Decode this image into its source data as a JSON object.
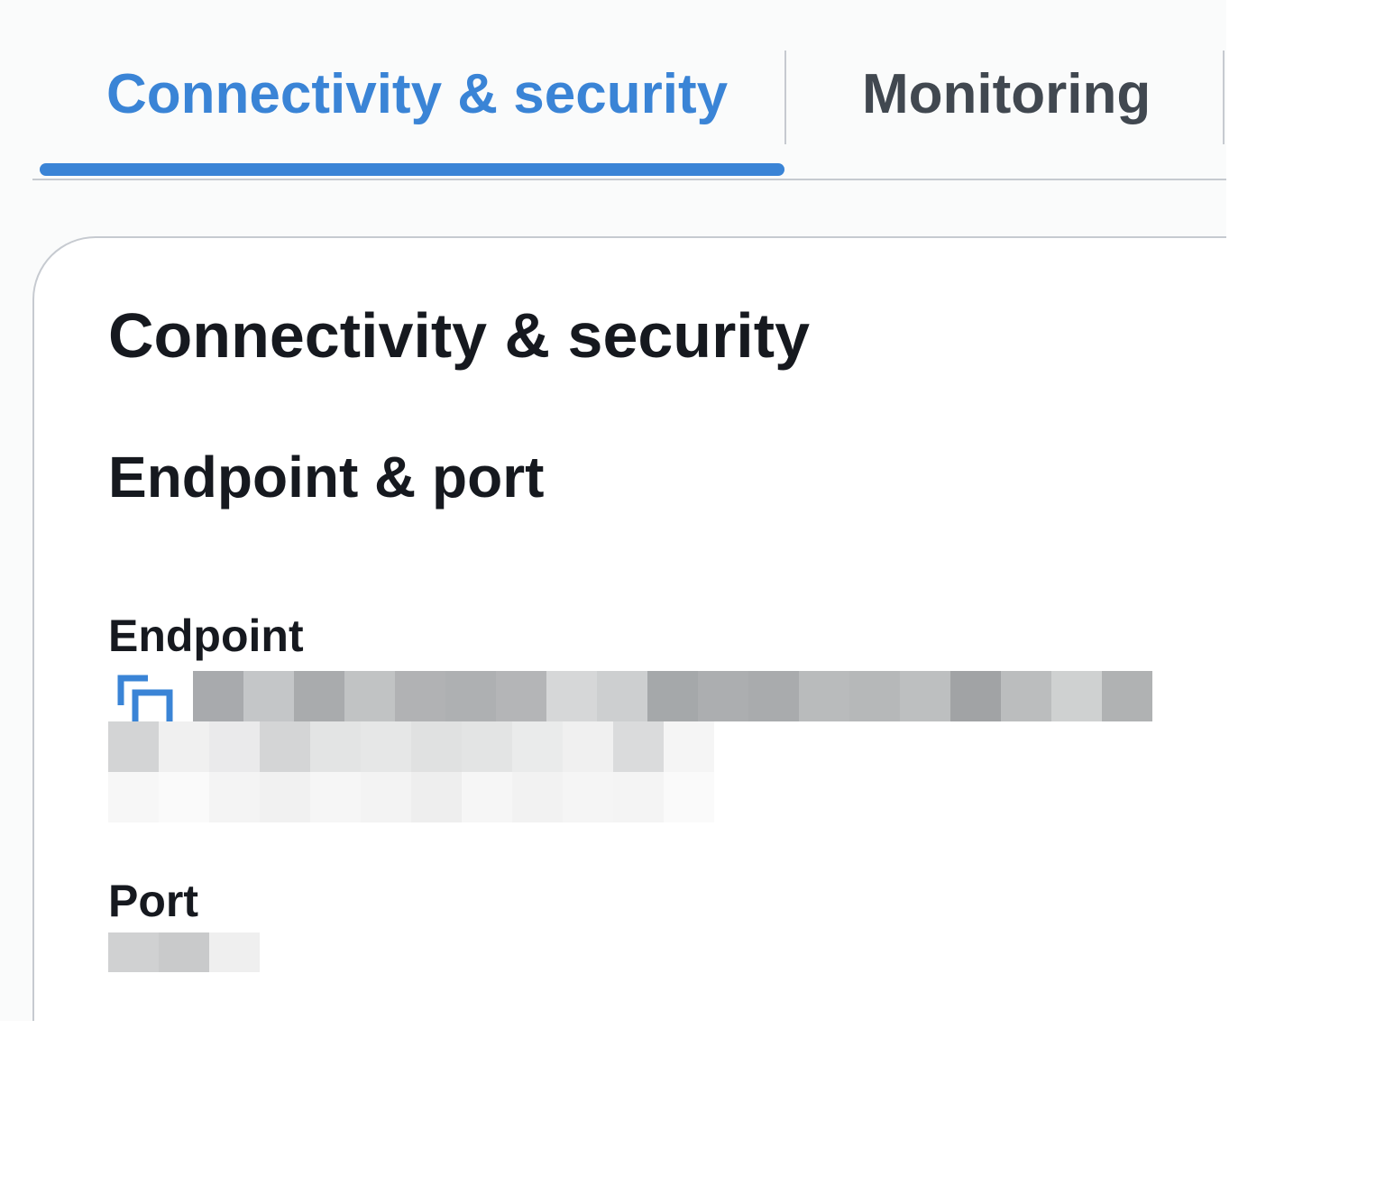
{
  "tabs": [
    {
      "label": "Connectivity & security",
      "active": true
    },
    {
      "label": "Monitoring",
      "active": false
    }
  ],
  "colors": {
    "accent": "#3a84d6",
    "text": "#16191f",
    "tab_inactive": "#414850",
    "border": "#c6cad0"
  },
  "panel": {
    "title": "Connectivity & security",
    "section_title": "Endpoint & port",
    "endpoint": {
      "label": "Endpoint",
      "copy_icon": "copy-icon",
      "value_redacted": true
    },
    "port": {
      "label": "Port",
      "value_redacted": true
    }
  }
}
